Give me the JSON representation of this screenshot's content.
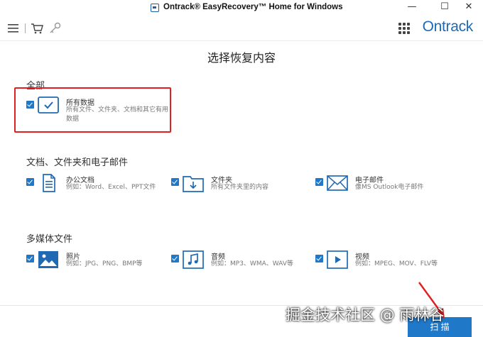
{
  "window": {
    "title": "Ontrack® EasyRecovery™ Home for Windows",
    "minimize": "—",
    "maximize": "☐",
    "close": "✕"
  },
  "toolbar": {
    "brand": "Ontrack",
    "icons": [
      "menu-icon",
      "cart-icon",
      "key-icon",
      "apps-grid-icon"
    ]
  },
  "main": {
    "title": "选择恢复内容",
    "sections": {
      "all": {
        "title": "全部",
        "items": [
          {
            "name": "所有数据",
            "desc": "所有文件、文件夹、文档和其它有用数据",
            "checked": true,
            "icon": "check-box-icon"
          }
        ]
      },
      "docs": {
        "title": "文档、文件夹和电子邮件",
        "items": [
          {
            "name": "办公文档",
            "desc": "例如：Word、Excel、PPT文件",
            "checked": true,
            "icon": "document-icon"
          },
          {
            "name": "文件夹",
            "desc": "所有文件夹里的内容",
            "checked": true,
            "icon": "folder-icon"
          },
          {
            "name": "电子邮件",
            "desc": "像MS Outlook电子邮件",
            "checked": true,
            "icon": "email-icon"
          }
        ]
      },
      "media": {
        "title": "多媒体文件",
        "items": [
          {
            "name": "照片",
            "desc": "例如：JPG、PNG、BMP等",
            "checked": true,
            "icon": "photo-icon"
          },
          {
            "name": "音频",
            "desc": "例如：MP3、WMA、WAV等",
            "checked": true,
            "icon": "music-icon"
          },
          {
            "name": "视频",
            "desc": "例如：MPEG、MOV、FLV等",
            "checked": true,
            "icon": "video-icon"
          }
        ]
      }
    }
  },
  "footer": {
    "next_label": "扫 描"
  },
  "overlay": {
    "watermark": "掘金技术社区 @ 雨林谷"
  },
  "colors": {
    "accent": "#1f78c8",
    "brand": "#1f6ab3",
    "highlight": "#e02020"
  }
}
